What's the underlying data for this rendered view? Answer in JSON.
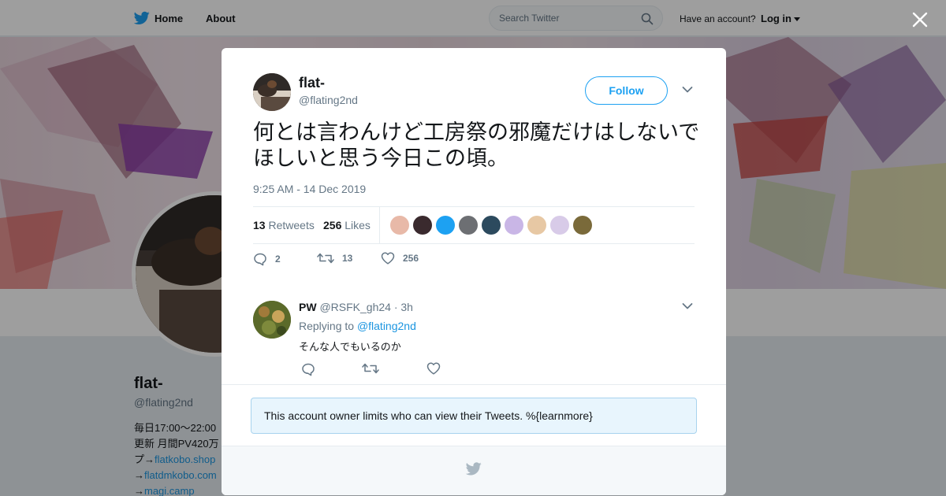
{
  "topbar": {
    "home_label": "Home",
    "about_label": "About",
    "search_placeholder": "Search Twitter",
    "have_account": "Have an account?",
    "login_label": "Log in"
  },
  "profile": {
    "name": "flat-",
    "handle": "@flating2nd",
    "bio_lines": [
      "毎日17:00〜22:00",
      "更新 月間PV420万",
      "プ→",
      "→",
      "→"
    ],
    "bio_links": [
      "flatkobo.shop",
      "flatdmkobo.com",
      "magi.camp"
    ]
  },
  "tweet": {
    "author_name": "flat-",
    "author_handle": "@flating2nd",
    "follow_label": "Follow",
    "text": "何とは言わんけど工房祭の邪魔だけはしないでほしいと思う今日この頃。",
    "timestamp": "9:25 AM - 14 Dec 2019",
    "retweets_count": "13",
    "retweets_label": "Retweets",
    "likes_count": "256",
    "likes_label": "Likes",
    "reply_action_count": "2",
    "retweet_action_count": "13",
    "like_action_count": "256",
    "liker_colors": [
      "#e8b9a8",
      "#3a2a2e",
      "#1da1f2",
      "#6d6f73",
      "#2c4a5e",
      "#c9b6e6",
      "#e7c8a4",
      "#d8cbe8",
      "#7a6a3a"
    ]
  },
  "reply": {
    "name": "PW",
    "handle": "@RSFK_gh24",
    "time": "3h",
    "replying_to_label": "Replying to",
    "replying_to_handle": "@flating2nd",
    "text": "そんな人でもいるのか"
  },
  "notice": {
    "text": "This account owner limits who can view their Tweets. %{learnmore}"
  },
  "colors": {
    "brand": "#1da1f2",
    "link": "#1b95e0",
    "notice_bg": "#e8f5fd"
  }
}
